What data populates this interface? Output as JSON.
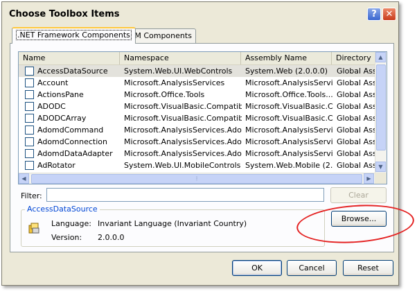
{
  "window": {
    "title": "Choose Toolbox Items",
    "help_glyph": "?",
    "close_glyph": "✕"
  },
  "tabs": [
    {
      "label": ".NET Framework Components",
      "active": true
    },
    {
      "label": "COM Components",
      "active": false
    }
  ],
  "list": {
    "columns": [
      "Name",
      "Namespace",
      "Assembly Name",
      "Directory"
    ],
    "rows": [
      {
        "checked": false,
        "name": "AccessDataSource",
        "namespace": "System.Web.UI.WebControls",
        "assembly": "System.Web (2.0.0.0)",
        "directory": "Global Ass",
        "selected": true
      },
      {
        "checked": false,
        "name": "Account",
        "namespace": "Microsoft.AnalysisServices",
        "assembly": "Microsoft.AnalysisServi...",
        "directory": "Global Ass"
      },
      {
        "checked": false,
        "name": "ActionsPane",
        "namespace": "Microsoft.Office.Tools",
        "assembly": "Microsoft.Office.Tools....",
        "directory": "Global Ass"
      },
      {
        "checked": false,
        "name": "ADODC",
        "namespace": "Microsoft.VisualBasic.Compatibi...",
        "assembly": "Microsoft.VisualBasic.C...",
        "directory": "Global Ass"
      },
      {
        "checked": false,
        "name": "ADODCArray",
        "namespace": "Microsoft.VisualBasic.Compatibi...",
        "assembly": "Microsoft.VisualBasic.C...",
        "directory": "Global Ass"
      },
      {
        "checked": false,
        "name": "AdomdCommand",
        "namespace": "Microsoft.AnalysisServices.Ado...",
        "assembly": "Microsoft.AnalysisServi...",
        "directory": "Global Ass"
      },
      {
        "checked": false,
        "name": "AdomdConnection",
        "namespace": "Microsoft.AnalysisServices.Ado...",
        "assembly": "Microsoft.AnalysisServi...",
        "directory": "Global Ass"
      },
      {
        "checked": false,
        "name": "AdomdDataAdapter",
        "namespace": "Microsoft.AnalysisServices.Ado...",
        "assembly": "Microsoft.AnalysisServi...",
        "directory": "Global Ass"
      },
      {
        "checked": false,
        "name": "AdRotator",
        "namespace": "System.Web.UI.MobileControls",
        "assembly": "System.Web.Mobile (2....",
        "directory": "Global Ass"
      }
    ]
  },
  "filter": {
    "label": "Filter:",
    "value": "",
    "clear_label": "Clear"
  },
  "details": {
    "title": "AccessDataSource",
    "language_label": "Language:",
    "language_value": "Invariant Language (Invariant Country)",
    "version_label": "Version:",
    "version_value": "2.0.0.0",
    "browse_label": "Browse..."
  },
  "buttons": {
    "ok": "OK",
    "cancel": "Cancel",
    "reset": "Reset"
  },
  "colors": {
    "annotation": "#e42222",
    "accent": "#0046d5",
    "tab_highlight": "#ffc83c"
  },
  "icons": {
    "component": "component-icon"
  }
}
